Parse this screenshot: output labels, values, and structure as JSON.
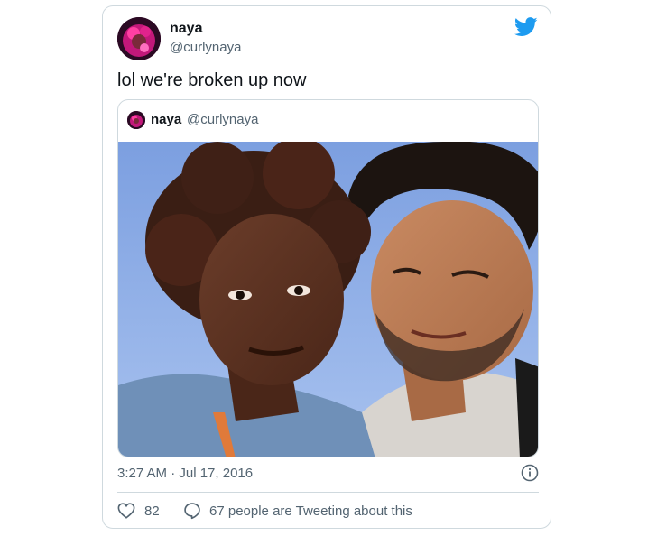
{
  "tweet": {
    "author": {
      "name": "naya",
      "handle": "@curlynaya"
    },
    "text": "lol we're broken up now",
    "timestamp": "3:27 AM · Jul 17, 2016",
    "likes": "82",
    "conversation_label": "67 people are Tweeting about this"
  },
  "quoted_tweet": {
    "author": {
      "name": "naya",
      "handle": "@curlynaya"
    }
  },
  "colors": {
    "twitter_blue": "#1d9bf0",
    "secondary_text": "#536471",
    "border": "#cfd9de"
  },
  "icons": {
    "brand": "twitter-bird-icon",
    "info": "info-icon",
    "like": "heart-icon",
    "reply": "speech-bubble-icon"
  }
}
